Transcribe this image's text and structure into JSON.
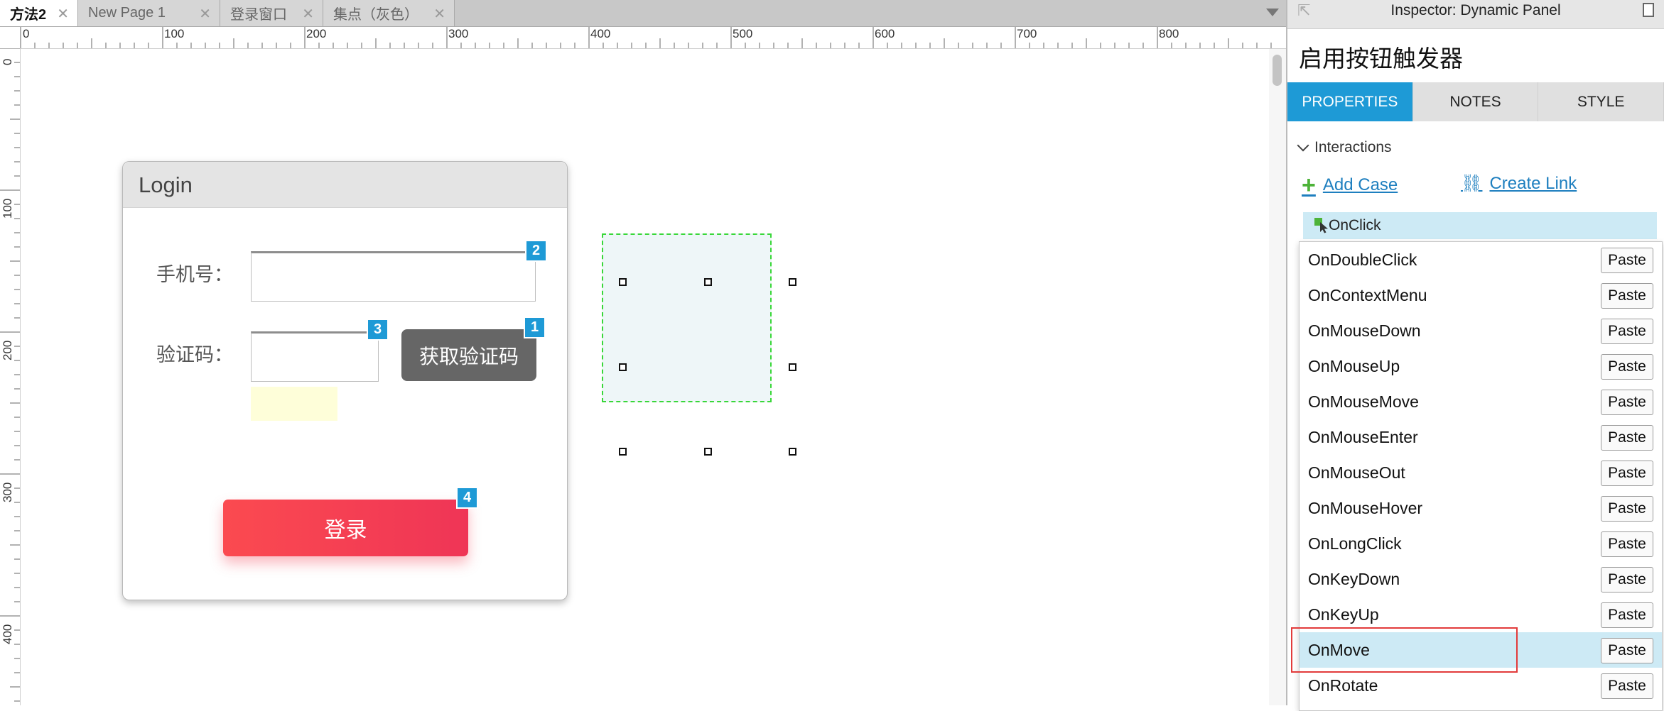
{
  "tabs": [
    {
      "label": "方法2",
      "active": true
    },
    {
      "label": "New Page 1",
      "active": false
    },
    {
      "label": "登录窗口",
      "active": false
    },
    {
      "label": "集点（灰色）",
      "active": false
    }
  ],
  "tab_close_glyph": "✕",
  "ruler": {
    "top_labels": [
      "0",
      "100",
      "200",
      "300",
      "400",
      "500",
      "600",
      "700",
      "800"
    ],
    "left_labels": [
      "0",
      "100",
      "200",
      "300",
      "400"
    ]
  },
  "login": {
    "title": "Login",
    "phone_label": "手机号：",
    "code_label": "验证码：",
    "get_code_button": "获取验证码",
    "submit_button": "登录",
    "badges": [
      "1",
      "2",
      "3",
      "4"
    ]
  },
  "inspector": {
    "title": "Inspector: Dynamic Panel",
    "widget_name": "启用按钮触发器",
    "tabs": [
      "PROPERTIES",
      "NOTES",
      "STYLE"
    ],
    "active_tab": "PROPERTIES",
    "section": "Interactions",
    "add_case": "Add Case",
    "create_link": "Create Link",
    "selected_event": "OnClick",
    "paste_label": "Paste",
    "events": [
      "OnDoubleClick",
      "OnContextMenu",
      "OnMouseDown",
      "OnMouseUp",
      "OnMouseMove",
      "OnMouseEnter",
      "OnMouseOut",
      "OnMouseHover",
      "OnLongClick",
      "OnKeyDown",
      "OnKeyUp",
      "OnMove",
      "OnRotate"
    ],
    "highlighted_event": "OnMove"
  },
  "colors": {
    "accent": "#1e9ad6",
    "login_button": "#f2385a",
    "panel_border": "#39d739",
    "highlight_row": "#cdeaf5",
    "annotation_box": "#e23b3b"
  }
}
